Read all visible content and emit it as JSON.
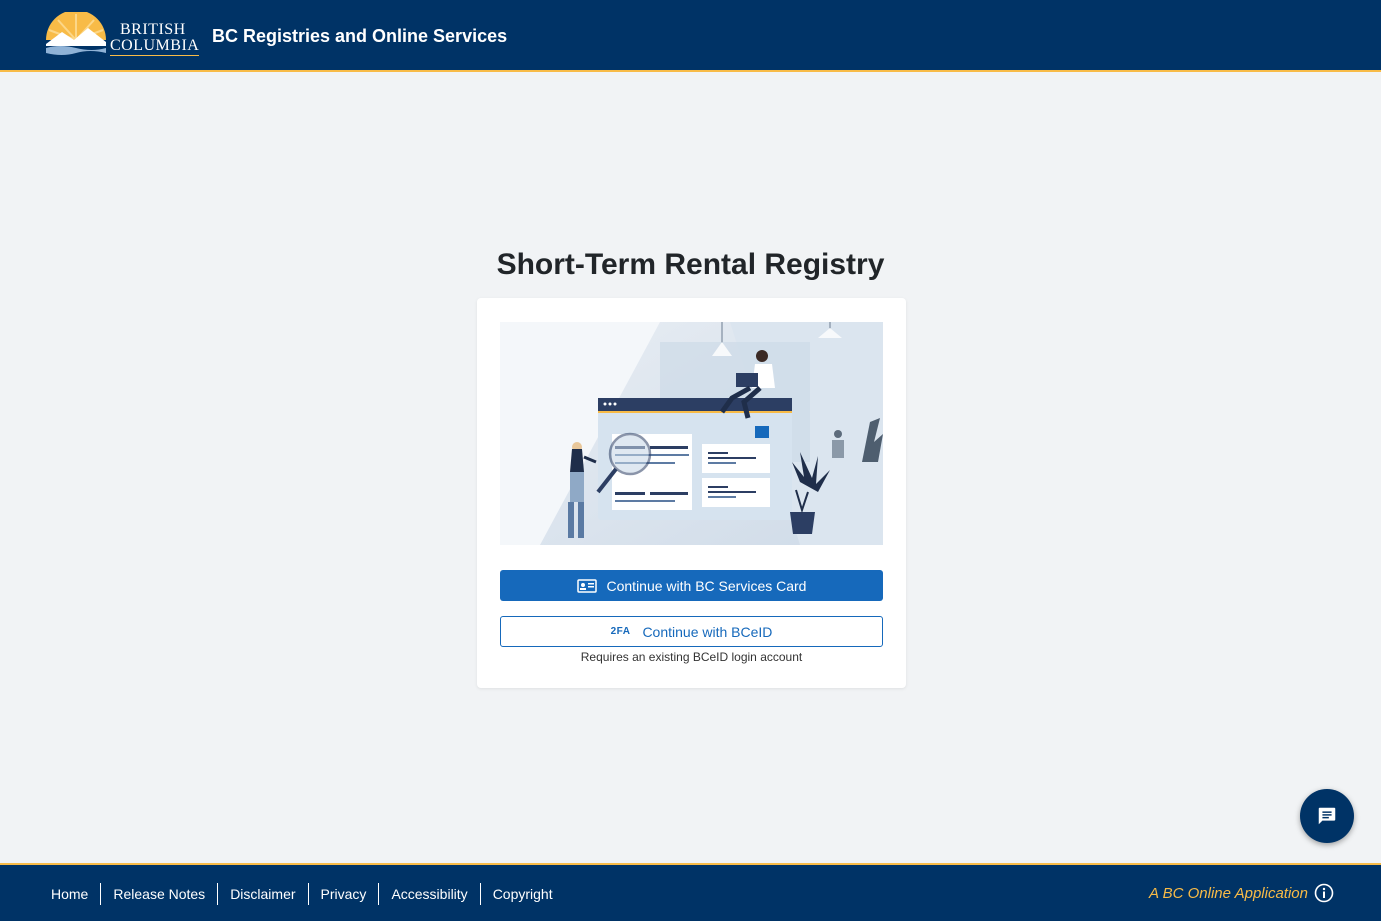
{
  "header": {
    "logo_line1": "BRITISH",
    "logo_line2": "COLUMBIA",
    "title": "BC Registries and Online Services"
  },
  "main": {
    "title": "Short-Term Rental Registry",
    "bcsc_button_label": "Continue with BC Services Card",
    "bceid_icon_text": "2FA",
    "bceid_button_label": "Continue with BCeID",
    "bceid_helper": "Requires an existing BCeID login account"
  },
  "footer": {
    "links": [
      "Home",
      "Release Notes",
      "Disclaimer",
      "Privacy",
      "Accessibility",
      "Copyright"
    ],
    "app_label": "A BC Online Application"
  },
  "icons": {
    "bcsc": "id-card-icon",
    "chat": "chat-icon",
    "info": "info-icon"
  },
  "colors": {
    "brand_navy": "#003366",
    "accent_gold": "#f8bb47",
    "primary_blue": "#1669bb"
  }
}
